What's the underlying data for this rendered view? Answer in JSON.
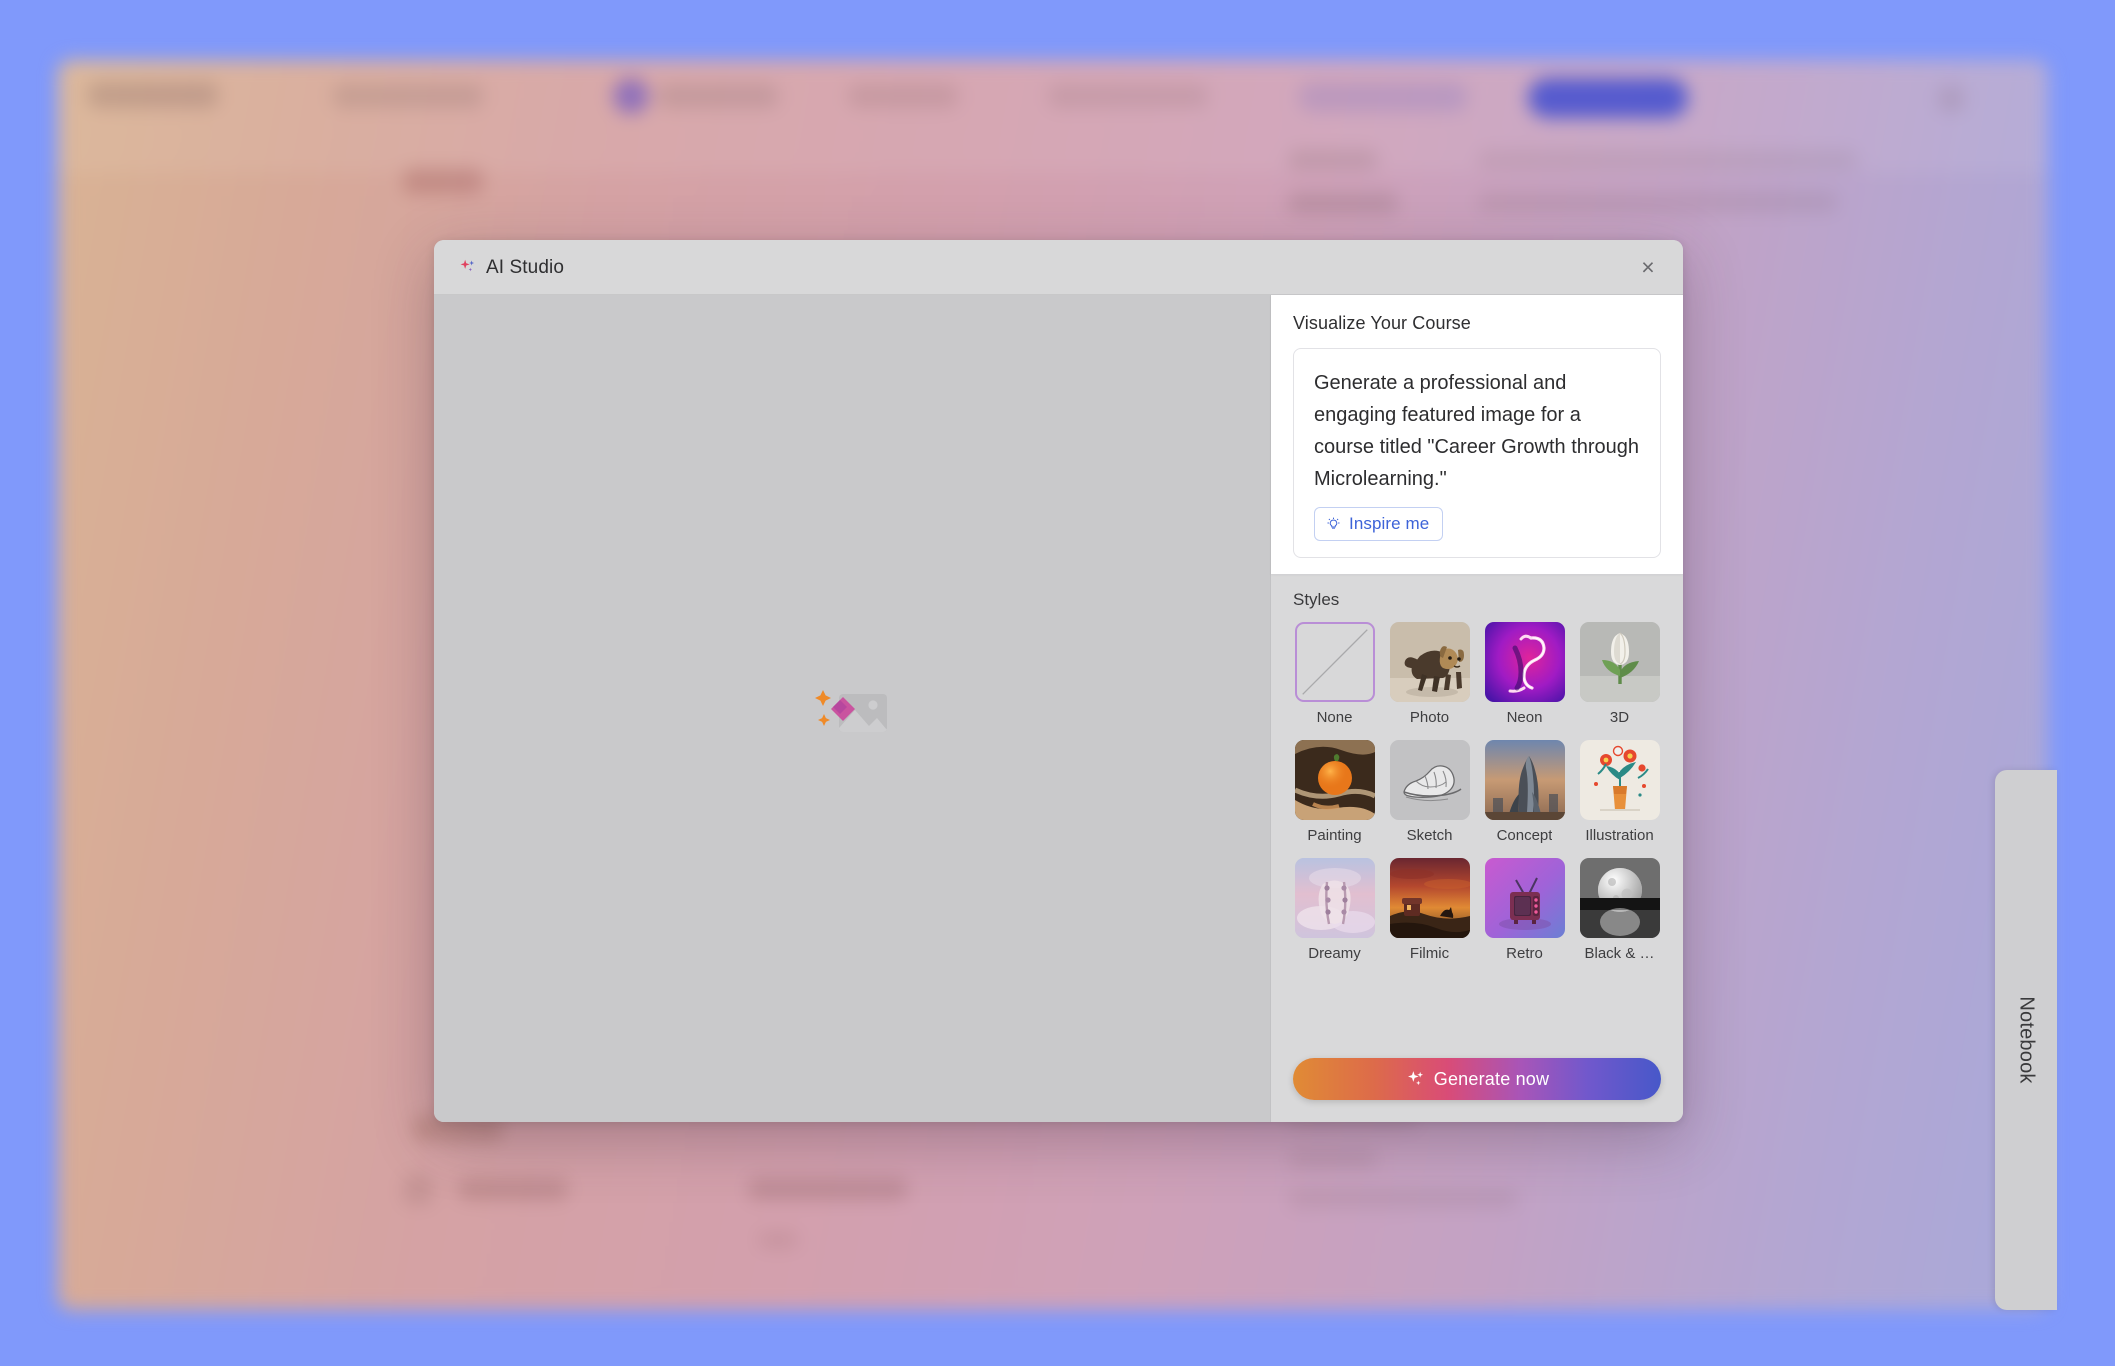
{
  "dialog": {
    "title": "AI Studio",
    "title_icon": "sparkles-icon",
    "close_icon": "×"
  },
  "canvas": {
    "placeholder_icon": "image-with-sparkles-placeholder-icon"
  },
  "prompt": {
    "heading": "Visualize Your Course",
    "text": "Generate a professional and engaging featured image for a course titled \"Career Growth through Microlearning.\"",
    "inspire_label": "Inspire me",
    "inspire_icon": "lightbulb-icon",
    "link_color": "#3d63d8"
  },
  "styles": {
    "heading": "Styles",
    "selected": "None",
    "selection_color": "#b98ed6",
    "items": [
      {
        "label": "None",
        "thumb": "diagonal-slash-empty"
      },
      {
        "label": "Photo",
        "thumb": "dog-photo"
      },
      {
        "label": "Neon",
        "thumb": "neon-flamingo"
      },
      {
        "label": "3D",
        "thumb": "3d-tulip"
      },
      {
        "label": "Painting",
        "thumb": "painted-orange"
      },
      {
        "label": "Sketch",
        "thumb": "pencil-sneaker"
      },
      {
        "label": "Concept",
        "thumb": "concept-tower"
      },
      {
        "label": "Illustration",
        "thumb": "flower-vase-illustration"
      },
      {
        "label": "Dreamy",
        "thumb": "dreamy-clouds"
      },
      {
        "label": "Filmic",
        "thumb": "filmic-sunset"
      },
      {
        "label": "Retro",
        "thumb": "retro-television"
      },
      {
        "label": "Black & …",
        "thumb": "black-white-sphere"
      }
    ]
  },
  "generate": {
    "label": "Generate now",
    "icon": "sparkles-icon",
    "gradient": [
      "#e08b35",
      "#d94c77",
      "#a855b8",
      "#4758c9"
    ]
  },
  "notebook_tab": {
    "label": "Notebook"
  },
  "backdrop": {
    "overlay_color": "#8099fb"
  }
}
